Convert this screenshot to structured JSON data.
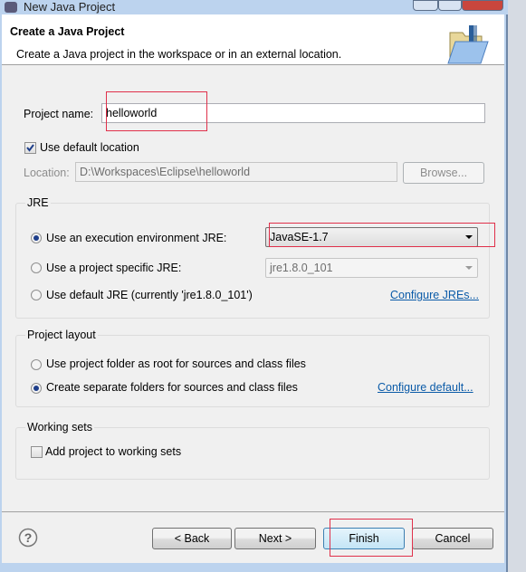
{
  "window": {
    "title": "New Java Project"
  },
  "header": {
    "title": "Create a Java Project",
    "description": "Create a Java project in the workspace or in an external location."
  },
  "project_name": {
    "label": "Project name:",
    "value": "helloworld"
  },
  "default_location": {
    "label": "Use default location",
    "checked": true
  },
  "location": {
    "label": "Location:",
    "value": "D:\\Workspaces\\Eclipse\\helloworld",
    "browse": "Browse..."
  },
  "jre": {
    "title": "JRE",
    "exec_env": "Use an execution environment JRE:",
    "exec_env_value": "JavaSE-1.7",
    "specific": "Use a project specific JRE:",
    "specific_value": "jre1.8.0_101",
    "default": "Use default JRE (currently 'jre1.8.0_101')",
    "configure": "Configure JREs...",
    "selected": "exec_env"
  },
  "layout": {
    "title": "Project layout",
    "root": "Use project folder as root for sources and class files",
    "separate": "Create separate folders for sources and class files",
    "configure": "Configure default...",
    "selected": "separate"
  },
  "working_sets": {
    "title": "Working sets",
    "add": "Add project to working sets",
    "checked": false
  },
  "buttons": {
    "back": "< Back",
    "next": "Next >",
    "finish": "Finish",
    "cancel": "Cancel"
  },
  "help_icon": "question-mark",
  "accent": "#e0304a"
}
